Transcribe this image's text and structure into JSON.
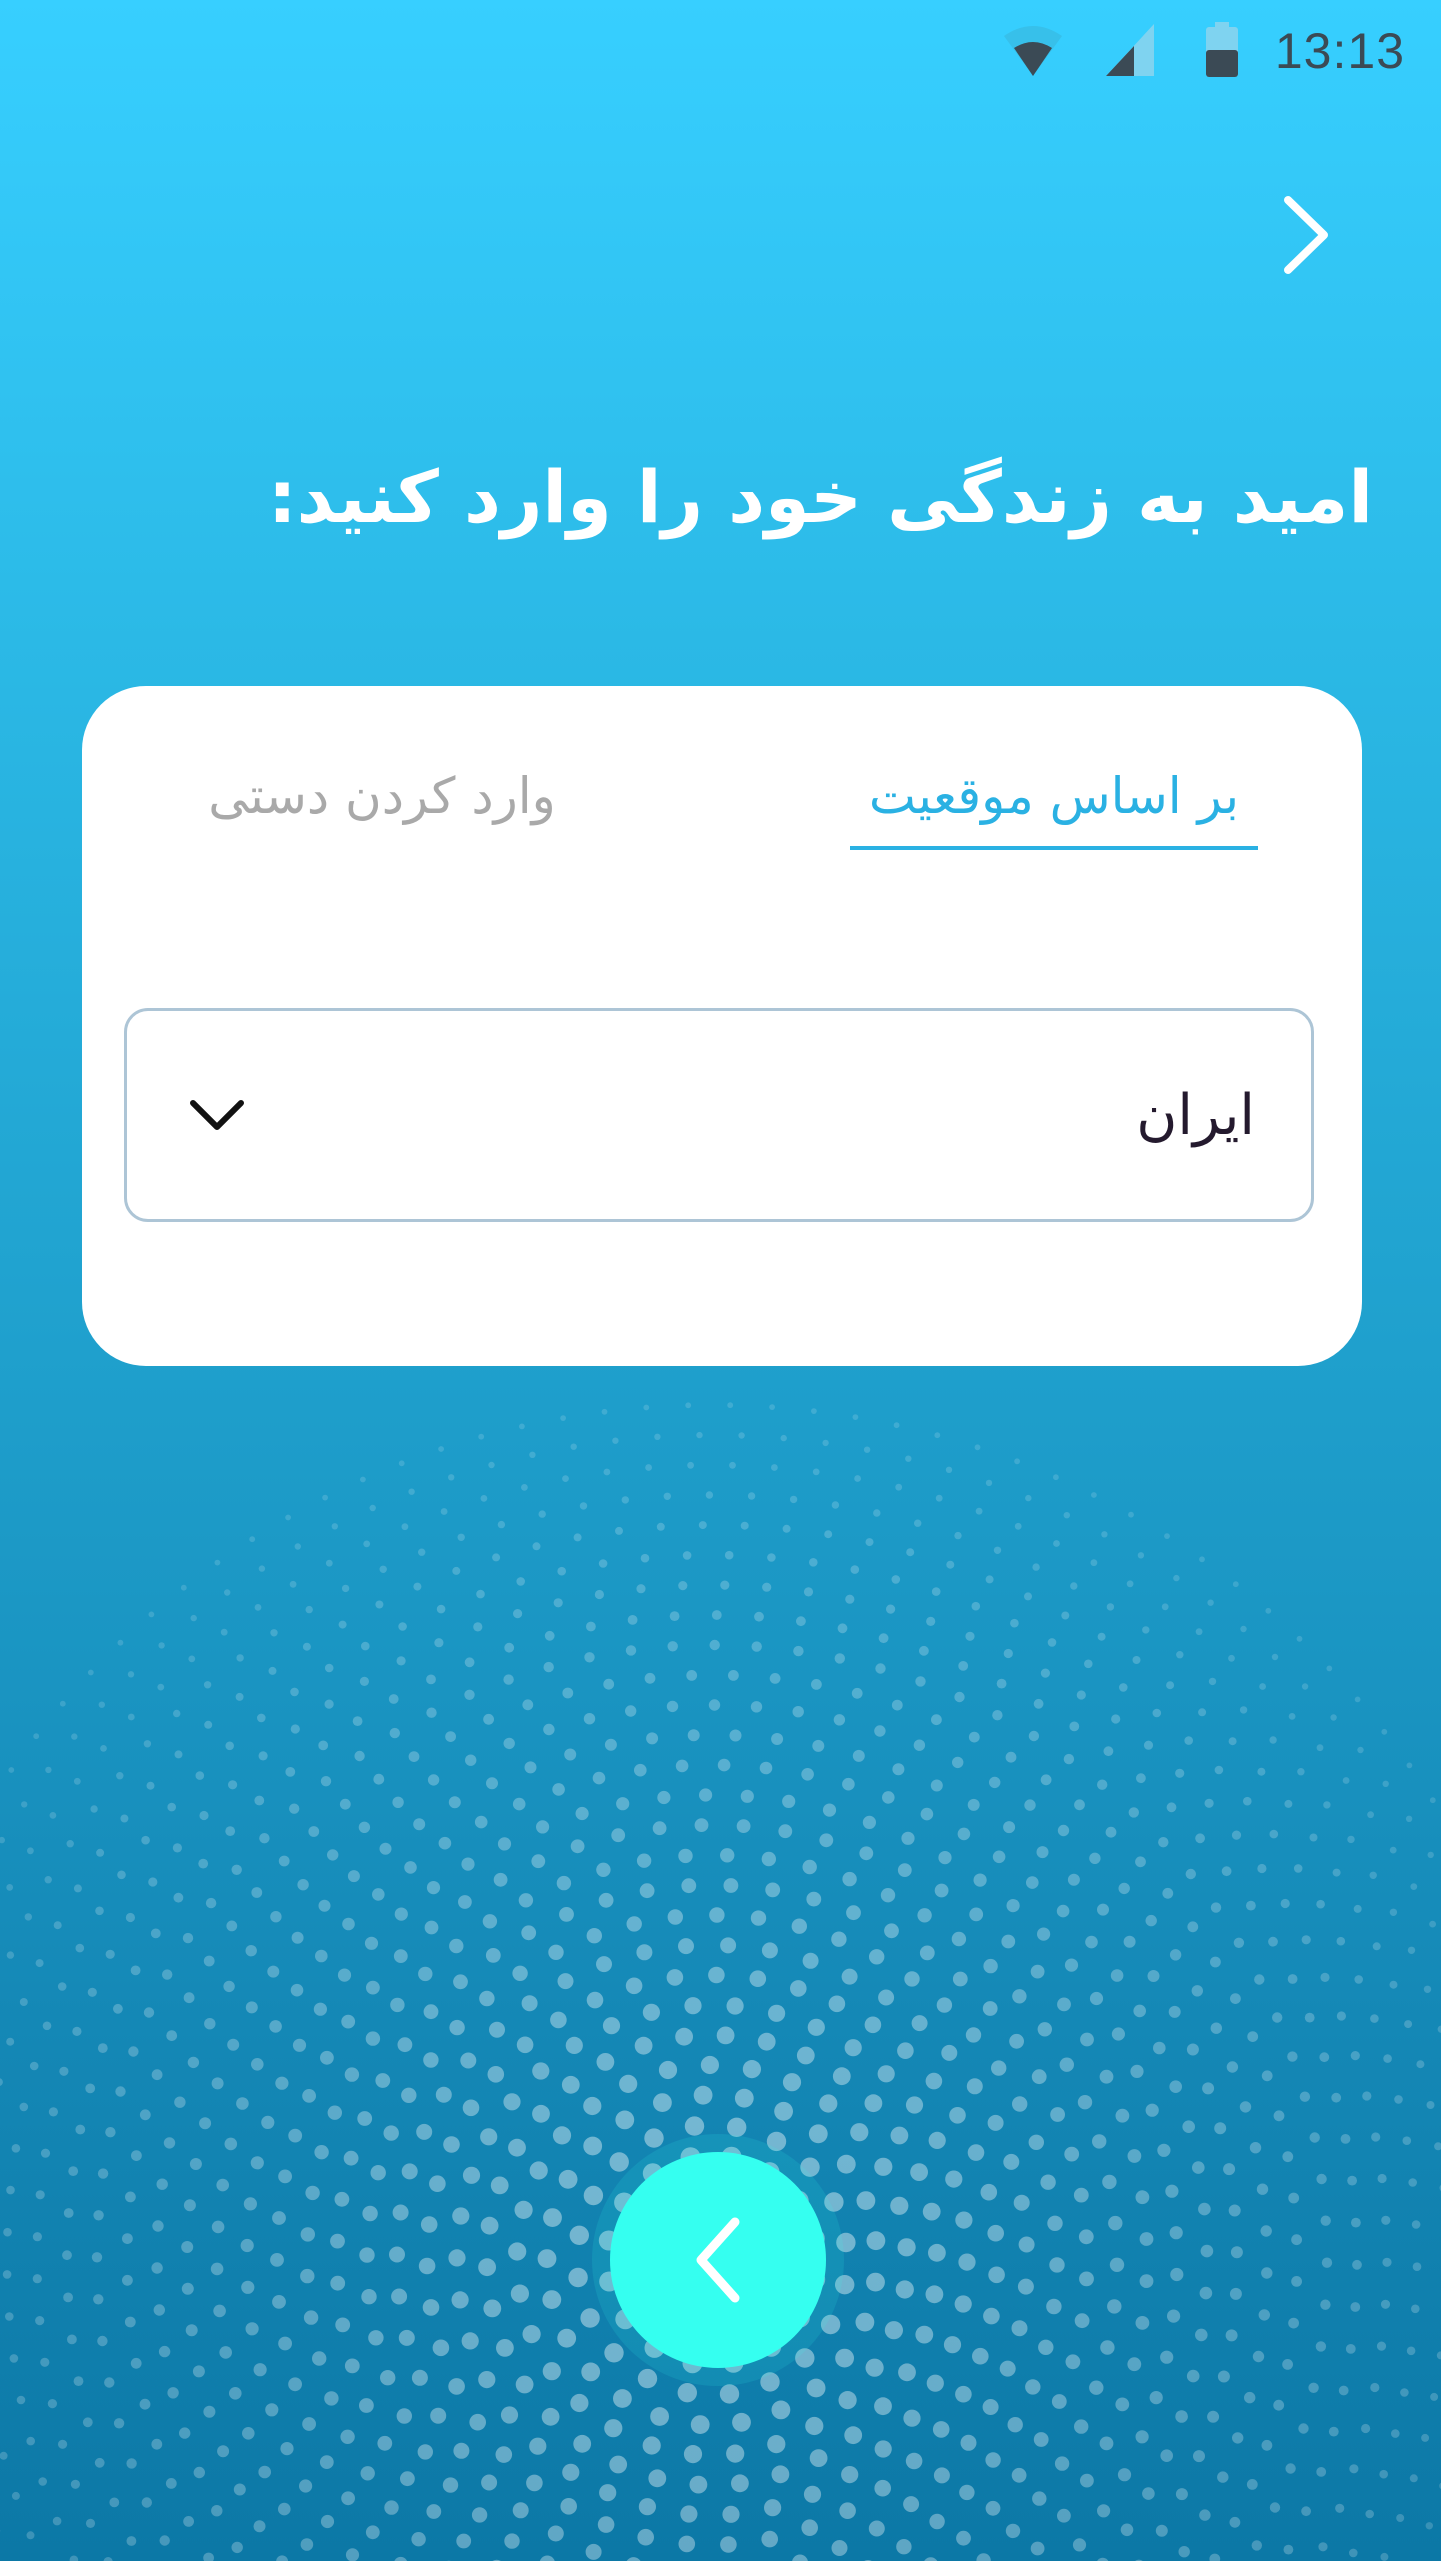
{
  "status_bar": {
    "time": "13:13",
    "icons": [
      "wifi-icon",
      "signal-icon",
      "battery-icon"
    ]
  },
  "header": {
    "forward_icon": "chevron-right-icon"
  },
  "title": "امید به زندگی خود را وارد کنید:",
  "tabs": [
    {
      "label": "بر اساس موقعیت",
      "active": true
    },
    {
      "label": "وارد کردن دستی",
      "active": false
    }
  ],
  "country_select": {
    "value": "ایران",
    "icon": "chevron-down-icon"
  },
  "next_button": {
    "icon": "chevron-left-icon",
    "color": "#35fff0"
  },
  "colors": {
    "background_top": "#37cfff",
    "background_bottom": "#0c78a6",
    "accent": "#2ab1e3",
    "inactive_tab": "#a9a9a9"
  }
}
